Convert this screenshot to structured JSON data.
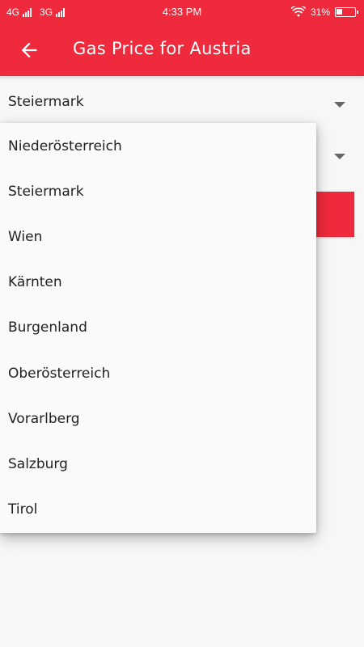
{
  "status_bar": {
    "network1": "4G",
    "network2": "3G",
    "time": "4:33 PM",
    "battery": "31%",
    "battery_level": 0.31
  },
  "app_bar": {
    "title": "Gas Price for Austria",
    "back_icon": "arrow-left-icon"
  },
  "state_spinner": {
    "selected": "Steiermark",
    "icon": "dropdown-arrow-icon"
  },
  "second_spinner": {
    "icon": "dropdown-arrow-icon"
  },
  "dropdown": {
    "options": [
      "Niederösterreich",
      "Steiermark",
      "Wien",
      "Kärnten",
      "Burgenland",
      "Oberösterreich",
      "Vorarlberg",
      "Salzburg",
      "Tirol"
    ]
  },
  "colors": {
    "primary": "#ee2a3c",
    "background": "#f7f7f7",
    "menu_background": "#fafafa"
  }
}
